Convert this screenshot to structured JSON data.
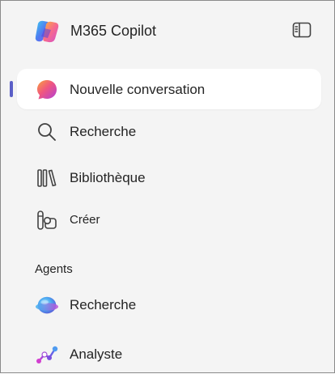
{
  "app": {
    "title": "M365 Copilot",
    "logo_icon": "copilot-logo",
    "toggle_icon": "sidebar-panel-icon"
  },
  "nav": {
    "new_chat": {
      "label": "Nouvelle conversation",
      "icon": "chat-bubble-icon",
      "active": true
    },
    "search": {
      "label": "Recherche",
      "icon": "search-icon"
    },
    "library": {
      "label": "Bibliothèque",
      "icon": "library-icon"
    },
    "create": {
      "label": "Créer",
      "icon": "create-icon"
    }
  },
  "agents": {
    "heading": "Agents",
    "items": [
      {
        "label": "Recherche",
        "icon": "researcher-agent-icon"
      },
      {
        "label": "Analyste",
        "icon": "analyst-agent-icon"
      }
    ]
  },
  "colors": {
    "accent": "#5b5fc7",
    "sidebar_bg": "#f4f4f4",
    "active_bg": "#ffffff",
    "text": "#242424"
  }
}
